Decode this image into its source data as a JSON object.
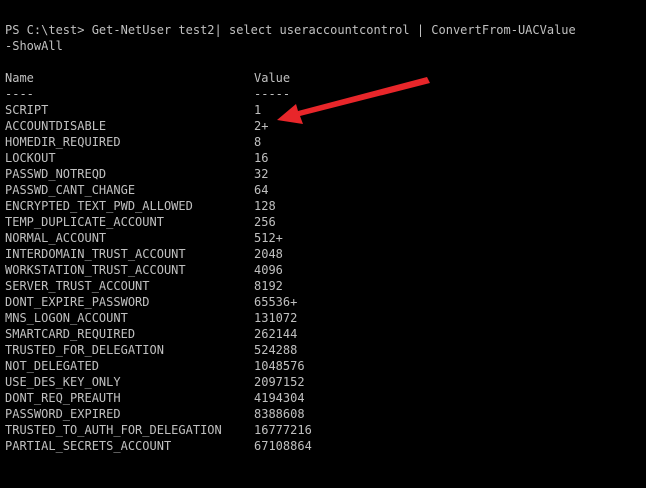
{
  "terminal": {
    "prompt": "PS C:\\test>",
    "command_line1": " Get-NetUser test2| select useraccountcontrol | ConvertFrom-UACValue",
    "command_line2": "-ShowAll",
    "header": {
      "name": "Name",
      "value": "Value",
      "name_sep": "----",
      "value_sep": "-----"
    },
    "rows": [
      {
        "name": "SCRIPT",
        "value": "1"
      },
      {
        "name": "ACCOUNTDISABLE",
        "value": "2+"
      },
      {
        "name": "HOMEDIR_REQUIRED",
        "value": "8"
      },
      {
        "name": "LOCKOUT",
        "value": "16"
      },
      {
        "name": "PASSWD_NOTREQD",
        "value": "32"
      },
      {
        "name": "PASSWD_CANT_CHANGE",
        "value": "64"
      },
      {
        "name": "ENCRYPTED_TEXT_PWD_ALLOWED",
        "value": "128"
      },
      {
        "name": "TEMP_DUPLICATE_ACCOUNT",
        "value": "256"
      },
      {
        "name": "NORMAL_ACCOUNT",
        "value": "512+"
      },
      {
        "name": "INTERDOMAIN_TRUST_ACCOUNT",
        "value": "2048"
      },
      {
        "name": "WORKSTATION_TRUST_ACCOUNT",
        "value": "4096"
      },
      {
        "name": "SERVER_TRUST_ACCOUNT",
        "value": "8192"
      },
      {
        "name": "DONT_EXPIRE_PASSWORD",
        "value": "65536+"
      },
      {
        "name": "MNS_LOGON_ACCOUNT",
        "value": "131072"
      },
      {
        "name": "SMARTCARD_REQUIRED",
        "value": "262144"
      },
      {
        "name": "TRUSTED_FOR_DELEGATION",
        "value": "524288"
      },
      {
        "name": "NOT_DELEGATED",
        "value": "1048576"
      },
      {
        "name": "USE_DES_KEY_ONLY",
        "value": "2097152"
      },
      {
        "name": "DONT_REQ_PREAUTH",
        "value": "4194304"
      },
      {
        "name": "PASSWORD_EXPIRED",
        "value": "8388608"
      },
      {
        "name": "TRUSTED_TO_AUTH_FOR_DELEGATION",
        "value": "16777216"
      },
      {
        "name": "PARTIAL_SECRETS_ACCOUNT",
        "value": "67108864"
      }
    ]
  },
  "annotation": {
    "icon": "red-arrow-icon",
    "color": "#e8262a"
  },
  "colors": {
    "background": "#000000",
    "text": "#c0c0c0"
  }
}
